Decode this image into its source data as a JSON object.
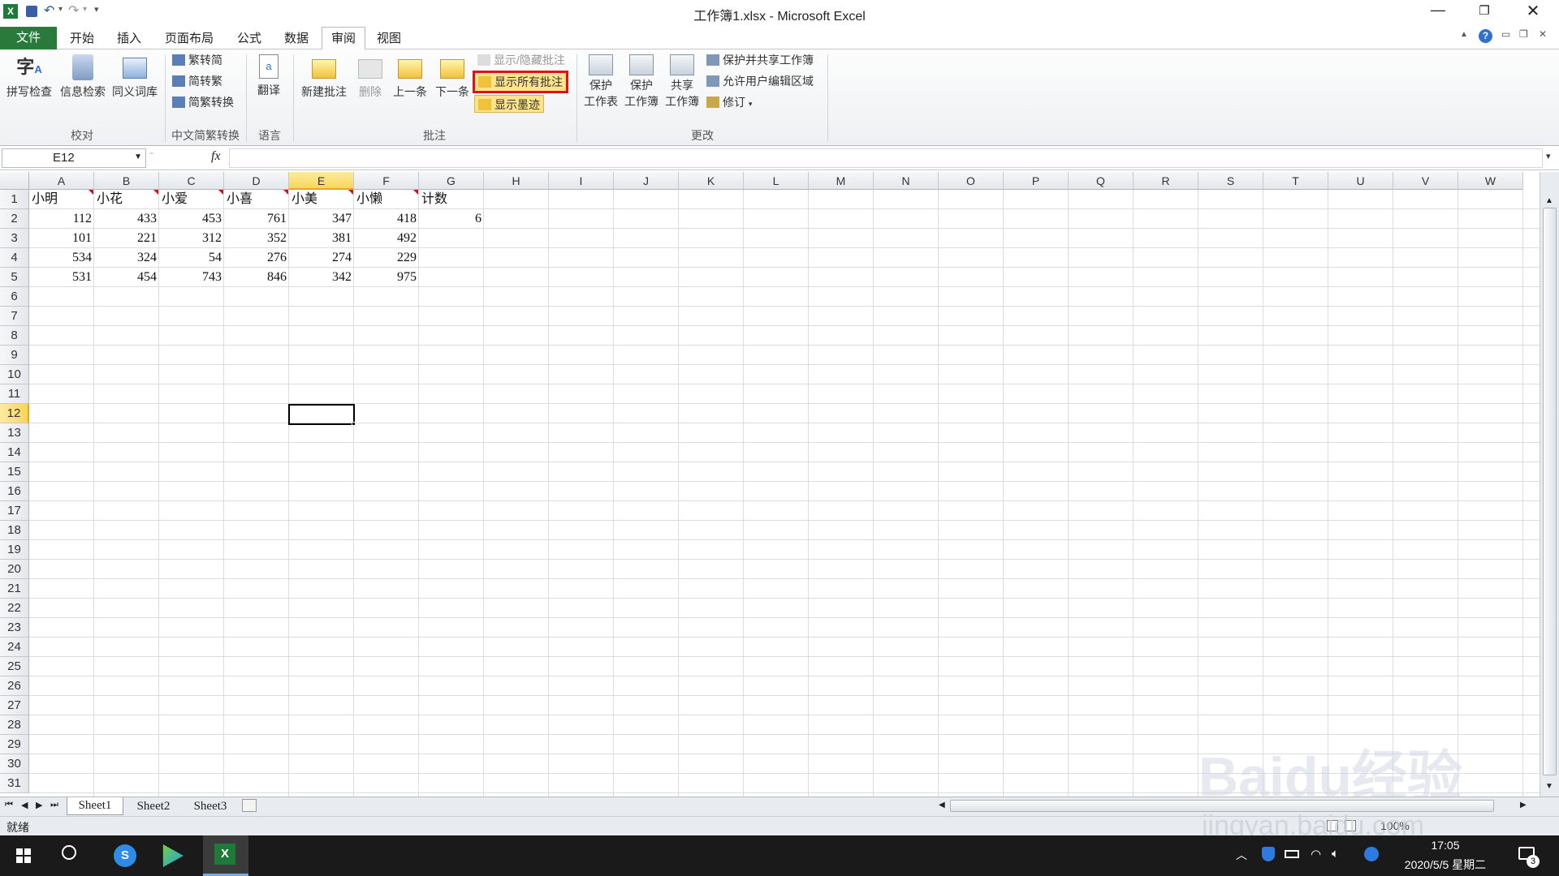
{
  "window": {
    "title": "工作簿1.xlsx - Microsoft Excel"
  },
  "tabs": [
    "开始",
    "插入",
    "页面布局",
    "公式",
    "数据",
    "审阅",
    "视图"
  ],
  "file_tab": "文件",
  "ribbon": {
    "proofing": {
      "spelling": "拼写检查",
      "research": "信息检索",
      "thesaurus": "同义词库",
      "group": "校对"
    },
    "chinese": {
      "t2s": "繁转简",
      "s2t": "简转繁",
      "convert": "简繁转换",
      "group": "中文简繁转换"
    },
    "language": {
      "translate": "翻译",
      "group": "语言"
    },
    "comments": {
      "new": "新建批注",
      "delete": "删除",
      "prev": "上一条",
      "next": "下一条",
      "show_hide": "显示/隐藏批注",
      "show_all": "显示所有批注",
      "show_ink": "显示墨迹",
      "group": "批注"
    },
    "changes": {
      "protect_sheet_1": "保护",
      "protect_sheet_2": "工作表",
      "protect_wb_1": "保护",
      "protect_wb_2": "工作簿",
      "share_wb_1": "共享",
      "share_wb_2": "工作簿",
      "protect_share": "保护并共享工作簿",
      "allow_edit": "允许用户编辑区域",
      "track": "修订",
      "group": "更改"
    }
  },
  "formula_bar": {
    "name_box": "E12",
    "fx": "fx",
    "value": ""
  },
  "columns": [
    "A",
    "B",
    "C",
    "D",
    "E",
    "F",
    "G",
    "H",
    "I",
    "J",
    "K",
    "L",
    "M",
    "N",
    "O",
    "P",
    "Q",
    "R",
    "S",
    "T",
    "U",
    "V",
    "W"
  ],
  "rows": [
    "1",
    "2",
    "3",
    "4",
    "5",
    "6",
    "7",
    "8",
    "9",
    "10",
    "11",
    "12",
    "13",
    "14",
    "15",
    "16",
    "17",
    "18",
    "19",
    "20",
    "21",
    "22",
    "23",
    "24",
    "25",
    "26",
    "27",
    "28",
    "29",
    "30",
    "31"
  ],
  "cells": {
    "header": [
      "小明",
      "小花",
      "小爱",
      "小喜",
      "小美",
      "小懒",
      "计数"
    ],
    "data": [
      [
        "112",
        "433",
        "453",
        "761",
        "347",
        "418",
        "6"
      ],
      [
        "101",
        "221",
        "312",
        "352",
        "381",
        "492",
        ""
      ],
      [
        "534",
        "324",
        "54",
        "276",
        "274",
        "229",
        ""
      ],
      [
        "531",
        "454",
        "743",
        "846",
        "342",
        "975",
        ""
      ]
    ]
  },
  "sheets": [
    "Sheet1",
    "Sheet2",
    "Sheet3"
  ],
  "status": {
    "ready": "就绪",
    "zoom": "100%"
  },
  "taskbar": {
    "time": "17:05",
    "date": "2020/5/5 星期二",
    "notif_count": "3"
  },
  "watermark": {
    "brand": "Baidu经验",
    "url": "jingyan.baidu.com"
  },
  "colors": {
    "file_tab": "#2a7a3c",
    "highlight_box": "#e0101c",
    "selected_header": "#fde27a",
    "comment_marker": "#d0101c"
  }
}
